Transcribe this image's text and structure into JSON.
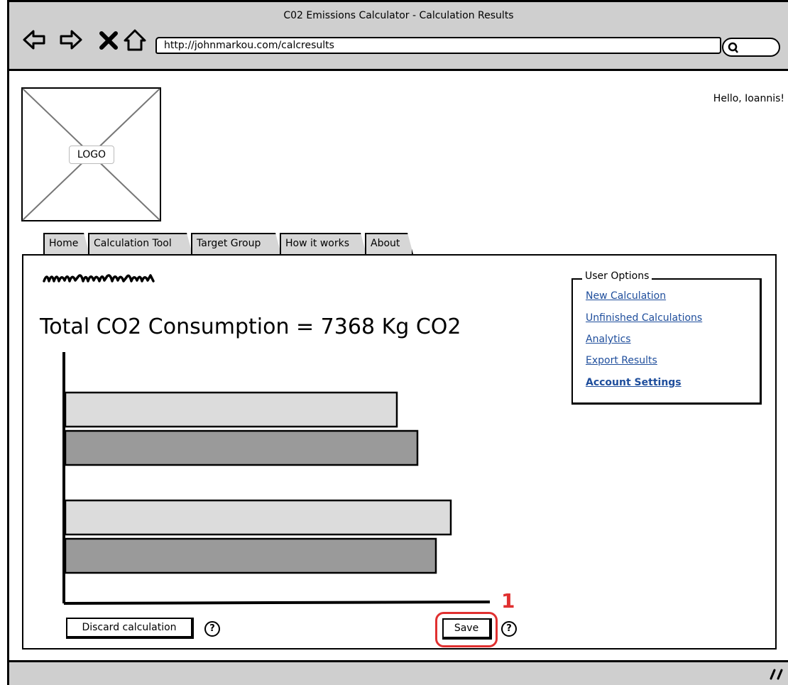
{
  "window": {
    "title": "C02 Emissions Calculator - Calculation Results",
    "url": "http://johnmarkou.com/calcresults"
  },
  "header": {
    "logo_label": "LOGO",
    "greeting": "Hello, Ioannis!"
  },
  "tabs": [
    {
      "label": "Home"
    },
    {
      "label": "Calculation Tool"
    },
    {
      "label": "Target Group"
    },
    {
      "label": "How it works"
    },
    {
      "label": "About"
    }
  ],
  "main": {
    "total_label": "Total CO2 Consumption = 7368 Kg CO2"
  },
  "user_options": {
    "legend": "User Options",
    "links": [
      {
        "label": "New Calculation"
      },
      {
        "label": "Unfinished Calculations"
      },
      {
        "label": "Analytics"
      },
      {
        "label": "Export Results"
      },
      {
        "label": "Account Settings"
      }
    ]
  },
  "actions": {
    "discard_label": "Discard calculation",
    "save_label": "Save",
    "help_glyph": "?"
  },
  "annotation": {
    "number": "1",
    "color": "#e03030"
  },
  "chart_data": {
    "type": "bar",
    "orientation": "horizontal",
    "title": "",
    "xlabel": "",
    "ylabel": "",
    "groups": [
      {
        "values": [
          467,
          496
        ],
        "colors": [
          "#dcdcdc",
          "#9a9a9a"
        ]
      },
      {
        "values": [
          543,
          522
        ],
        "colors": [
          "#dcdcdc",
          "#9a9a9a"
        ]
      }
    ],
    "xlim": [
      0,
      600
    ]
  }
}
